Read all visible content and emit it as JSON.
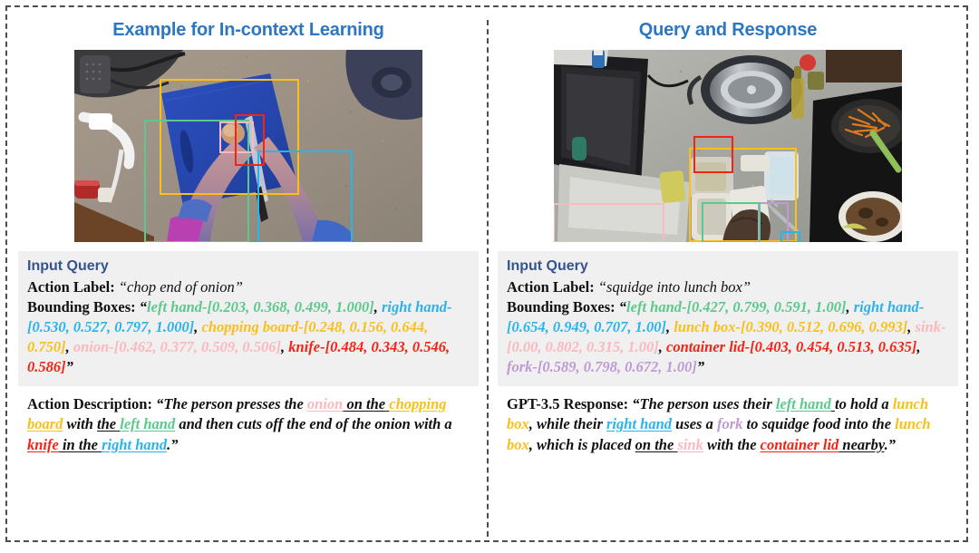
{
  "figure": {
    "panels": [
      {
        "id": "in-context-example",
        "title": "Example for In-context Learning",
        "image": {
          "alt": "Top-down view of hands chopping an onion on a blue chopping board",
          "boxes": [
            {
              "label": "chopping board",
              "color": "#f9bf1c",
              "coords": [
                0.248,
                0.156,
                0.644,
                0.75
              ]
            },
            {
              "label": "left hand",
              "color": "#5cc98c",
              "coords": [
                0.203,
                0.368,
                0.499,
                1.0
              ]
            },
            {
              "label": "right hand",
              "color": "#2bb3ec",
              "coords": [
                0.53,
                0.527,
                0.797,
                1.0
              ]
            },
            {
              "label": "onion",
              "color": "#fbb8be",
              "coords": [
                0.462,
                0.377,
                0.509,
                0.506
              ]
            },
            {
              "label": "knife",
              "color": "#f42414",
              "coords": [
                0.484,
                0.343,
                0.546,
                0.586
              ]
            }
          ]
        },
        "query": {
          "heading": "Input Query",
          "action_label_key": "Action Label:",
          "action_label_value": "“chop end of onion”",
          "bounding_boxes_key": "Bounding Boxes:",
          "bounding_boxes_open_quote": "“",
          "bounding_boxes_close_quote": "”",
          "boxes_text": [
            {
              "text": "left hand-[0.203, 0.368, 0.499, 1.000]",
              "color": "green"
            },
            {
              "text": "right hand-[0.530, 0.527, 0.797, 1.000]",
              "color": "blue"
            },
            {
              "text": "chopping board-[0.248, 0.156, 0.644, 0.750]",
              "color": "yellow"
            },
            {
              "text": "onion-[0.462, 0.377, 0.509, 0.506]",
              "color": "pink"
            },
            {
              "text": "knife-[0.484, 0.343, 0.546, 0.586]",
              "color": "red"
            }
          ]
        },
        "answer": {
          "key": "Action Description:",
          "open_quote": "“",
          "close_quote": ".”",
          "segments": [
            {
              "t": "The person presses the ",
              "c": "black",
              "u": false
            },
            {
              "t": "onion",
              "c": "pink",
              "u": true
            },
            {
              "t": " ",
              "c": "black",
              "u": true
            },
            {
              "t": "on the",
              "c": "black",
              "u": true
            },
            {
              "t": " ",
              "c": "black",
              "u": true
            },
            {
              "t": "chopping board",
              "c": "yellow",
              "u": true
            },
            {
              "t": " with ",
              "c": "black",
              "u": false
            },
            {
              "t": "the",
              "c": "black",
              "u": true
            },
            {
              "t": " ",
              "c": "black",
              "u": true
            },
            {
              "t": "left hand",
              "c": "green",
              "u": true
            },
            {
              "t": " and then cuts off the end of the onion with a ",
              "c": "black",
              "u": false
            },
            {
              "t": "knife",
              "c": "red",
              "u": true
            },
            {
              "t": " ",
              "c": "black",
              "u": true
            },
            {
              "t": "in the",
              "c": "black",
              "u": true
            },
            {
              "t": " ",
              "c": "black",
              "u": true
            },
            {
              "t": "right hand",
              "c": "blue",
              "u": true
            }
          ]
        }
      },
      {
        "id": "query-and-response",
        "title": "Query and Response",
        "image": {
          "alt": "Top-down view of a kitchen counter with a pot, lunch boxes and a hand",
          "boxes": [
            {
              "label": "lunch box",
              "color": "#f9bf1c",
              "coords": [
                0.39,
                0.512,
                0.696,
                0.993
              ]
            },
            {
              "label": "sink",
              "color": "#fbb8be",
              "coords": [
                0.0,
                0.802,
                0.315,
                1.0
              ]
            },
            {
              "label": "container lid",
              "color": "#f42414",
              "coords": [
                0.403,
                0.454,
                0.513,
                0.635
              ]
            },
            {
              "label": "fork",
              "color": "#bd9ad4",
              "coords": [
                0.589,
                0.798,
                0.672,
                1.0
              ]
            },
            {
              "label": "left hand",
              "color": "#5cc98c",
              "coords": [
                0.427,
                0.799,
                0.591,
                1.0
              ]
            },
            {
              "label": "right hand",
              "color": "#2bb3ec",
              "coords": [
                0.654,
                0.949,
                0.707,
                1.0
              ]
            }
          ]
        },
        "query": {
          "heading": "Input Query",
          "action_label_key": "Action Label:",
          "action_label_value": "“squidge into lunch box”",
          "bounding_boxes_key": "Bounding Boxes:",
          "bounding_boxes_open_quote": "“",
          "bounding_boxes_close_quote": "”",
          "boxes_text": [
            {
              "text": "left hand-[0.427, 0.799, 0.591, 1.00]",
              "color": "green"
            },
            {
              "text": "right hand-[0.654, 0.949, 0.707, 1.00]",
              "color": "blue"
            },
            {
              "text": "lunch box-[0.390, 0.512, 0.696, 0.993]",
              "color": "yellow"
            },
            {
              "text": "sink-[0.00, 0.802, 0.315, 1.00]",
              "color": "pink"
            },
            {
              "text": "container lid-[0.403, 0.454, 0.513, 0.635]",
              "color": "red"
            },
            {
              "text": "fork-[0.589, 0.798, 0.672, 1.00]",
              "color": "purple"
            }
          ]
        },
        "answer": {
          "key": "GPT-3.5 Response:",
          "open_quote": "“",
          "close_quote": ".”",
          "segments": [
            {
              "t": "The person uses their ",
              "c": "black",
              "u": false
            },
            {
              "t": "left hand",
              "c": "green",
              "u": true
            },
            {
              "t": " ",
              "c": "black",
              "u": true
            },
            {
              "t": "to hold a ",
              "c": "black",
              "u": false
            },
            {
              "t": "lunch box",
              "c": "yellow",
              "u": false
            },
            {
              "t": ", while their ",
              "c": "black",
              "u": false
            },
            {
              "t": "right hand",
              "c": "blue",
              "u": true
            },
            {
              "t": " uses a ",
              "c": "black",
              "u": false
            },
            {
              "t": "fork",
              "c": "purple",
              "u": false
            },
            {
              "t": " to squidge food into the ",
              "c": "black",
              "u": false
            },
            {
              "t": "lunch box",
              "c": "yellow",
              "u": false
            },
            {
              "t": ", which is placed ",
              "c": "black",
              "u": false
            },
            {
              "t": "on the",
              "c": "black",
              "u": true
            },
            {
              "t": " ",
              "c": "black",
              "u": true
            },
            {
              "t": "sink",
              "c": "pink",
              "u": true
            },
            {
              "t": " with the ",
              "c": "black",
              "u": false
            },
            {
              "t": "container lid",
              "c": "red",
              "u": true
            },
            {
              "t": " ",
              "c": "black",
              "u": true
            },
            {
              "t": "nearby",
              "c": "black",
              "u": true
            }
          ]
        }
      }
    ],
    "colors": {
      "title": "#2b77c2",
      "query_heading": "#35548f",
      "query_box_bg": "#f0f0f0",
      "green": "#5cc98c",
      "blue": "#2bb3ec",
      "yellow": "#f9bf1c",
      "pink": "#fbb8be",
      "red": "#f42414",
      "purple": "#bd9ad4"
    }
  }
}
